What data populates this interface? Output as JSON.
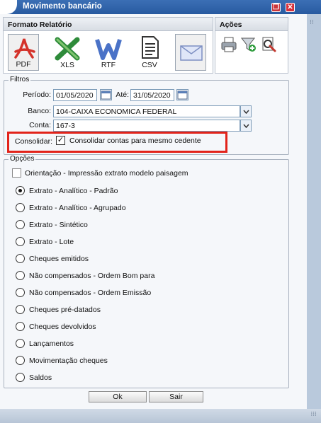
{
  "window": {
    "title": "Movimento bancário",
    "restore_glyph": "❐",
    "close_glyph": "✕"
  },
  "formats": {
    "title": "Formato Relatório",
    "buttons": [
      {
        "label": "PDF",
        "icon": "pdf-icon",
        "color": "#d4322a"
      },
      {
        "label": "XLS",
        "icon": "excel-icon",
        "color": "#2e8b3a"
      },
      {
        "label": "RTF",
        "icon": "word-icon",
        "color": "#4a72c7"
      },
      {
        "label": "CSV",
        "icon": "csv-icon",
        "color": "#333333"
      }
    ],
    "email_icon": "email-icon"
  },
  "actions": {
    "title": "Ações",
    "icons": [
      "printer-icon",
      "filter-add-icon",
      "preview-icon"
    ]
  },
  "filters": {
    "legend": "Filtros",
    "periodo_label": "Período:",
    "periodo_from": "01/05/2020",
    "ate_label": "Até:",
    "periodo_to": "31/05/2020",
    "banco_label": "Banco:",
    "banco_value": "104-CAIXA ECONOMICA FEDERAL",
    "conta_label": "Conta:",
    "conta_value": "167-3",
    "consolidar_label": "Consolidar:",
    "consolidar_check_label": "Consolidar contas para mesmo cedente",
    "consolidar_checked": true
  },
  "options": {
    "legend": "Opções",
    "orientation_label": "Orientação - Impressão extrato modelo paisagem",
    "orientation_checked": false,
    "radios": [
      {
        "label": "Extrato - Analítico - Padrão",
        "checked": true
      },
      {
        "label": "Extrato - Analítico - Agrupado",
        "checked": false
      },
      {
        "label": "Extrato - Sintético",
        "checked": false
      },
      {
        "label": "Extrato - Lote",
        "checked": false
      },
      {
        "label": "Cheques emitidos",
        "checked": false
      },
      {
        "label": "Não compensados - Ordem Bom para",
        "checked": false
      },
      {
        "label": "Não compensados - Ordem Emissão",
        "checked": false
      },
      {
        "label": "Cheques pré-datados",
        "checked": false
      },
      {
        "label": "Cheques devolvidos",
        "checked": false
      },
      {
        "label": "Lançamentos",
        "checked": false
      },
      {
        "label": "Movimentação cheques",
        "checked": false
      },
      {
        "label": "Saldos",
        "checked": false
      }
    ]
  },
  "footer": {
    "ok_label": "Ok",
    "cancel_label": "Sair"
  },
  "colors": {
    "title_bar": "#2f63aa",
    "highlight": "#e2231a"
  }
}
